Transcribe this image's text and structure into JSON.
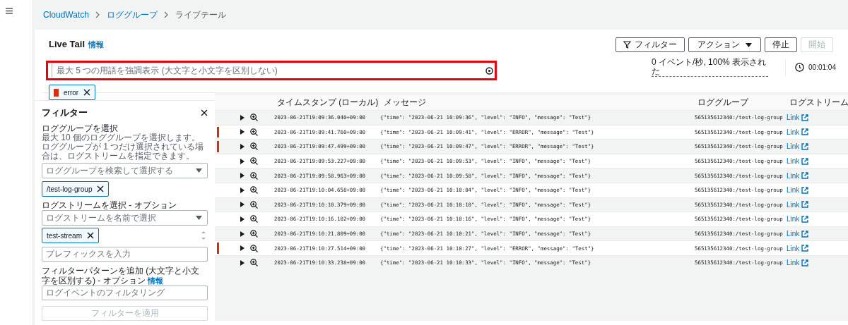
{
  "breadcrumbs": [
    {
      "label": "CloudWatch",
      "link": true
    },
    {
      "label": "ロググループ",
      "link": true
    },
    {
      "label": "ライブテール",
      "link": false
    }
  ],
  "header": {
    "title": "Live Tail",
    "info": "情報",
    "buttons": [
      {
        "label": "フィルター",
        "kind": "filter",
        "disabled": false
      },
      {
        "label": "アクション",
        "kind": "dropdown",
        "disabled": false
      },
      {
        "label": "停止",
        "kind": "plain",
        "disabled": false
      },
      {
        "label": "開始",
        "kind": "plain",
        "disabled": true
      }
    ]
  },
  "highlight_search": {
    "placeholder": "最大 5 つの用語を強調表示 (大文字と小文字を区別しない)",
    "highlighted": true
  },
  "stats": {
    "rate": "0 イベント/秒, 100% 表示された",
    "elapsed": "00:01:04"
  },
  "highlight_terms": [
    {
      "label": "error",
      "color": "#d13212"
    }
  ],
  "filter_panel": {
    "title": "フィルター",
    "log_group": {
      "label": "ロググループを選択",
      "description": "最大 10 個のロググループを選択します。ロググループが 1 つだけ選択されている場合は、ログストリームを指定できます。",
      "placeholder": "ロググループを検索して選択する",
      "tokens": [
        "/test-log-group"
      ]
    },
    "log_stream": {
      "label": "ログストリームを選択 - オプション",
      "placeholder": "ログストリームを名前で選択",
      "tokens": [
        "test-stream"
      ],
      "prefix_placeholder": "プレフィックスを入力"
    },
    "pattern": {
      "label": "フィルターパターンを追加 (大文字と小文字を区別する) - オプション",
      "info": "情報",
      "placeholder": "ログイベントのフィルタリング"
    },
    "apply_button": {
      "label": "フィルターを適用",
      "disabled": true
    }
  },
  "table": {
    "columns": [
      "タイムスタンプ (ローカル)",
      "メッセージ",
      "ロググループ",
      "ログストリーム"
    ],
    "rows": [
      {
        "timestamp": "2023-06-21T19:09:36.040+09:00",
        "message": "{\"time\": \"2023-06-21 10:09:36\", \"level\": \"INFO\", \"message\": \"Test\"}",
        "log_group": "565135612340:/test-log-group",
        "stream": "Link",
        "highlighted": false
      },
      {
        "timestamp": "2023-06-21T19:09:41.760+09:00",
        "message": "{\"time\": \"2023-06-21 10:09:41\", \"level\": \"ERROR\", \"message\": \"Test\"}",
        "log_group": "565135612340:/test-log-group",
        "stream": "Link",
        "highlighted": true
      },
      {
        "timestamp": "2023-06-21T19:09:47.499+09:00",
        "message": "{\"time\": \"2023-06-21 10:09:47\", \"level\": \"ERROR\", \"message\": \"Test\"}",
        "log_group": "565135612340:/test-log-group",
        "stream": "Link",
        "highlighted": true
      },
      {
        "timestamp": "2023-06-21T19:09:53.227+09:00",
        "message": "{\"time\": \"2023-06-21 10:09:53\", \"level\": \"INFO\", \"message\": \"Test\"}",
        "log_group": "565135612340:/test-log-group",
        "stream": "Link",
        "highlighted": false
      },
      {
        "timestamp": "2023-06-21T19:09:58.963+09:00",
        "message": "{\"time\": \"2023-06-21 10:09:58\", \"level\": \"INFO\", \"message\": \"Test\"}",
        "log_group": "565135612340:/test-log-group",
        "stream": "Link",
        "highlighted": false
      },
      {
        "timestamp": "2023-06-21T19:10:04.658+09:00",
        "message": "{\"time\": \"2023-06-21 10:10:04\", \"level\": \"INFO\", \"message\": \"Test\"}",
        "log_group": "565135612340:/test-log-group",
        "stream": "Link",
        "highlighted": false
      },
      {
        "timestamp": "2023-06-21T19:10:10.379+09:00",
        "message": "{\"time\": \"2023-06-21 10:10:10\", \"level\": \"INFO\", \"message\": \"Test\"}",
        "log_group": "565135612340:/test-log-group",
        "stream": "Link",
        "highlighted": false
      },
      {
        "timestamp": "2023-06-21T19:10:16.102+09:00",
        "message": "{\"time\": \"2023-06-21 10:10:16\", \"level\": \"INFO\", \"message\": \"Test\"}",
        "log_group": "565135612340:/test-log-group",
        "stream": "Link",
        "highlighted": false
      },
      {
        "timestamp": "2023-06-21T19:10:21.809+09:00",
        "message": "{\"time\": \"2023-06-21 10:10:21\", \"level\": \"INFO\", \"message\": \"Test\"}",
        "log_group": "565135612340:/test-log-group",
        "stream": "Link",
        "highlighted": false
      },
      {
        "timestamp": "2023-06-21T19:10:27.514+09:00",
        "message": "{\"time\": \"2023-06-21 10:10:27\", \"level\": \"ERROR\", \"message\": \"Test\"}",
        "log_group": "565135612340:/test-log-group",
        "stream": "Link",
        "highlighted": true
      },
      {
        "timestamp": "2023-06-21T19:10:33.238+09:00",
        "message": "{\"time\": \"2023-06-21 10:10:33\", \"level\": \"INFO\", \"message\": \"Test\"}",
        "log_group": "565135612340:/test-log-group",
        "stream": "Link",
        "highlighted": false
      }
    ]
  }
}
